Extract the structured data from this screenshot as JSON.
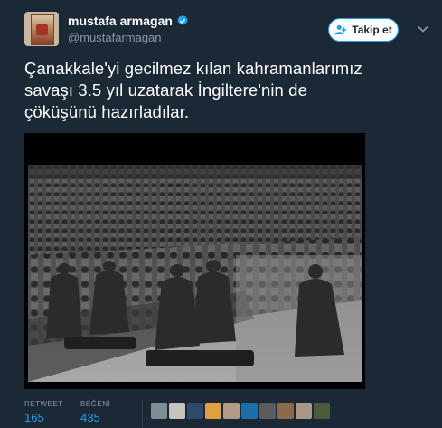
{
  "user": {
    "display_name": "mustafa armagan",
    "handle": "@mustafarmagan"
  },
  "follow_button": {
    "label": "Takip et"
  },
  "tweet": {
    "line1": "Çanakkale'yi gecilmez kılan kahramanlarımız",
    "line2": "savaşı 3.5 yıl uzatarak İngiltere'nin de",
    "line3": "çöküşünü hazırladılar."
  },
  "stats": {
    "retweet_label": "RETWEET",
    "retweet_count": "165",
    "like_label": "BEĞENİ",
    "like_count": "435"
  },
  "colors": {
    "background": "#1b2836",
    "accent": "#1da1f2",
    "muted": "#8899a6"
  },
  "icons": [
    "verified-icon",
    "add-user-icon",
    "chevron-down-icon"
  ],
  "liker_avatar_count": 10
}
